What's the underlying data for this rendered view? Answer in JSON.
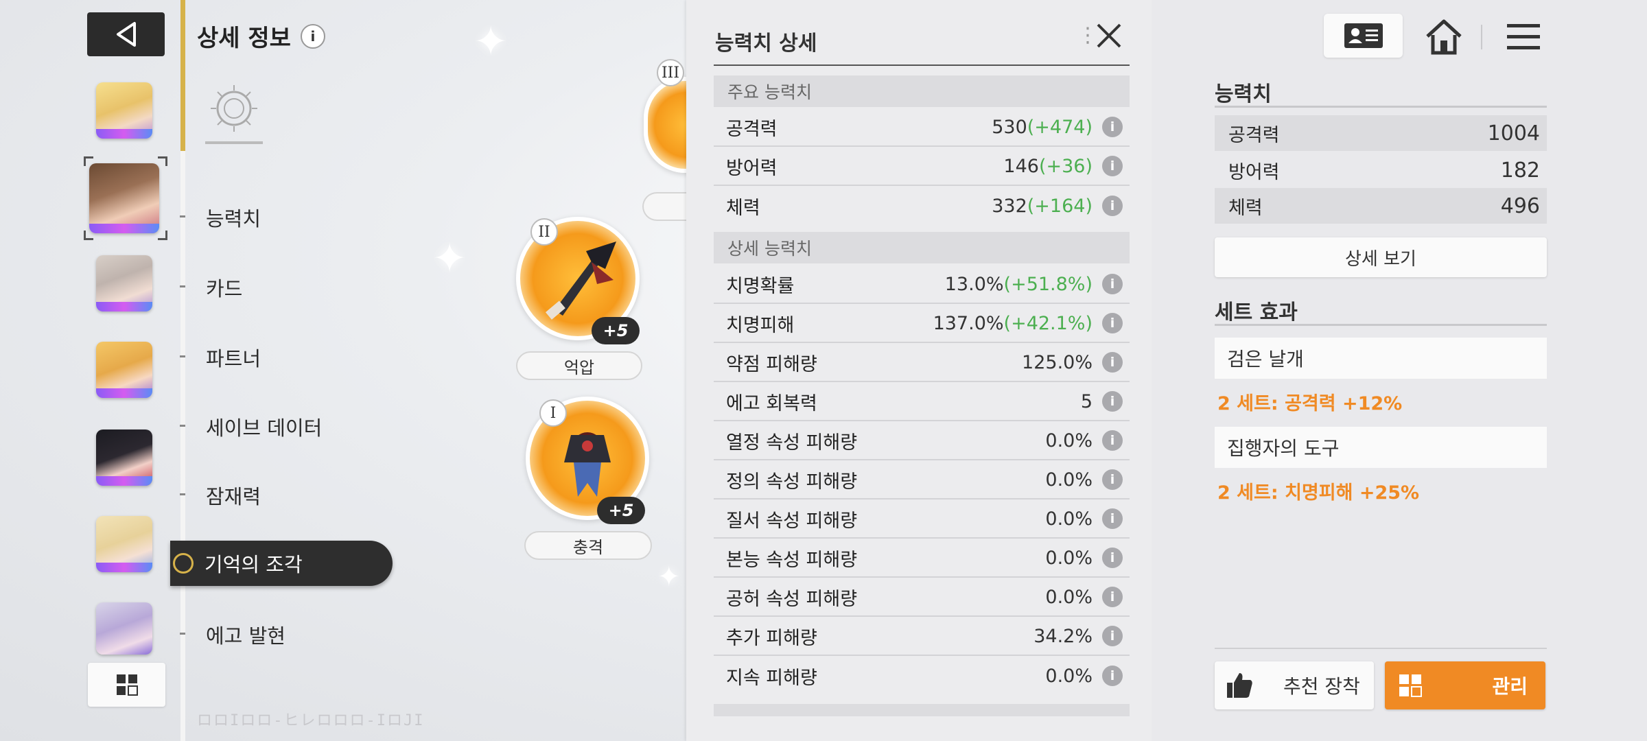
{
  "nav": {
    "title": "상세 정보",
    "info_icon_label": "i",
    "items": [
      "능력치",
      "카드",
      "파트너",
      "세이브 데이터",
      "잠재력",
      "기억의 조각",
      "에고 발현"
    ],
    "active_index": 5,
    "bottom_logo": "ロロIロロ-ヒレロロロ-IロJI"
  },
  "avatars": [
    "avatar-blonde",
    "avatar-brown-selected",
    "avatar-silver",
    "avatar-blonde-2",
    "avatar-black-red",
    "avatar-blonde-3",
    "avatar-silver-purple"
  ],
  "slots": [
    {
      "roman": "III",
      "label": "",
      "plus": ""
    },
    {
      "roman": "II",
      "label": "억압",
      "plus": "+5"
    },
    {
      "roman": "I",
      "label": "충격",
      "plus": "+5"
    }
  ],
  "stats_panel": {
    "title": "능력치 상세",
    "main_header": "주요 능력치",
    "detail_header": "상세 능력치",
    "main_stats": [
      {
        "name": "공격력",
        "value": "530",
        "bonus": "(+474)"
      },
      {
        "name": "방어력",
        "value": "146",
        "bonus": "(+36)"
      },
      {
        "name": "체력",
        "value": "332",
        "bonus": "(+164)"
      }
    ],
    "detail_stats": [
      {
        "name": "치명확률",
        "value": "13.0%",
        "bonus": "(+51.8%)"
      },
      {
        "name": "치명피해",
        "value": "137.0%",
        "bonus": "(+42.1%)"
      },
      {
        "name": "약점 피해량",
        "value": "125.0%",
        "bonus": ""
      },
      {
        "name": "에고 회복력",
        "value": "5",
        "bonus": ""
      },
      {
        "name": "열정 속성 피해량",
        "value": "0.0%",
        "bonus": ""
      },
      {
        "name": "정의 속성 피해량",
        "value": "0.0%",
        "bonus": ""
      },
      {
        "name": "질서 속성 피해량",
        "value": "0.0%",
        "bonus": ""
      },
      {
        "name": "본능 속성 피해량",
        "value": "0.0%",
        "bonus": ""
      },
      {
        "name": "공허 속성 피해량",
        "value": "0.0%",
        "bonus": ""
      },
      {
        "name": "추가 피해량",
        "value": "34.2%",
        "bonus": ""
      },
      {
        "name": "지속 피해량",
        "value": "0.0%",
        "bonus": ""
      }
    ],
    "info_icon_label": "i"
  },
  "right_panel": {
    "stats_title": "능력치",
    "stats": [
      {
        "name": "공격력",
        "value": "1004"
      },
      {
        "name": "방어력",
        "value": "182"
      },
      {
        "name": "체력",
        "value": "496"
      }
    ],
    "detail_button": "상세 보기",
    "set_title": "세트 효과",
    "sets": [
      {
        "name": "검은 날개",
        "effect": "2 세트: 공격력 +12%"
      },
      {
        "name": "집행자의 도구",
        "effect": "2 세트: 치명피해 +25%"
      }
    ],
    "recommend_button": "추천 장착",
    "manage_button": "관리"
  },
  "colors": {
    "accent_orange": "#f08a24",
    "bonus_green": "#4caf50",
    "nav_gold": "#d6b24a",
    "dark": "#2e2e2e"
  },
  "icons": [
    "back-arrow-icon",
    "grid-icon",
    "info-icon",
    "emblem-icon",
    "close-icon",
    "profile-card-icon",
    "home-icon",
    "menu-icon",
    "thumbs-up-icon",
    "manage-grid-icon"
  ]
}
